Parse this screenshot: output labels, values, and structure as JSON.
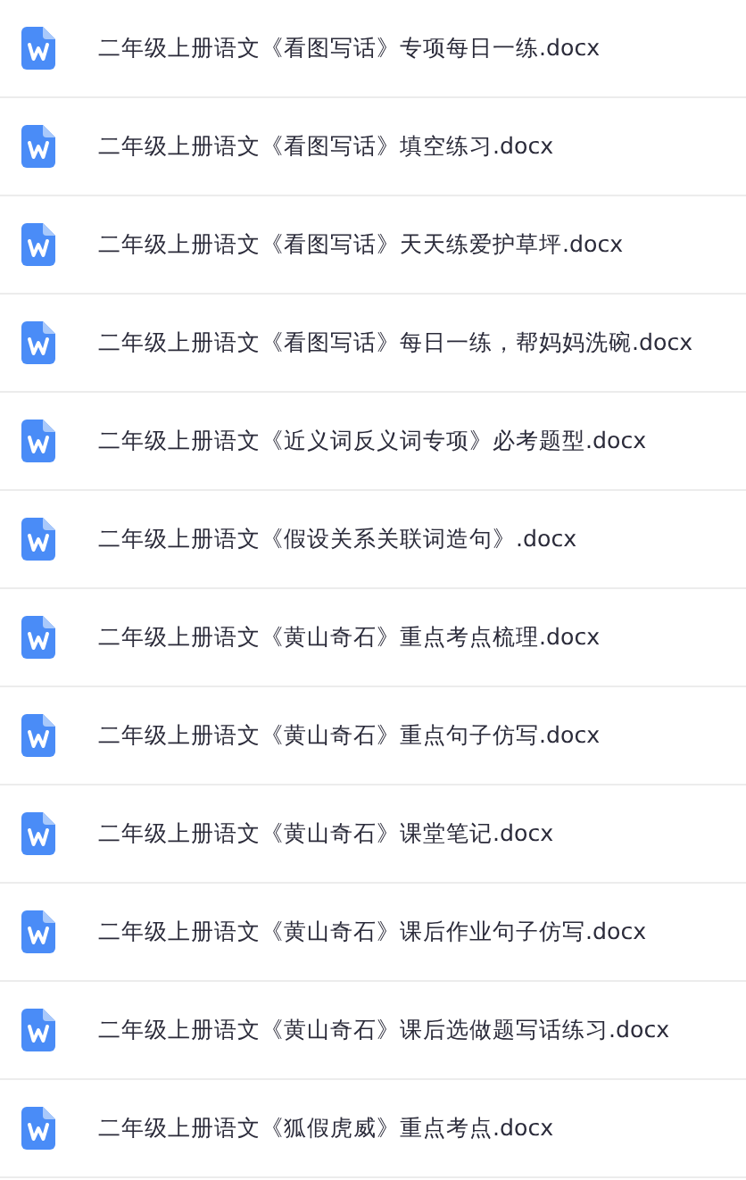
{
  "files": [
    {
      "name": "二年级上册语文《看图写话》专项每日一练.docx"
    },
    {
      "name": "二年级上册语文《看图写话》填空练习.docx"
    },
    {
      "name": "二年级上册语文《看图写话》天天练爱护草坪.docx"
    },
    {
      "name": "二年级上册语文《看图写话》每日一练，帮妈妈洗碗.docx"
    },
    {
      "name": "二年级上册语文《近义词反义词专项》必考题型.docx"
    },
    {
      "name": "二年级上册语文《假设关系关联词造句》.docx"
    },
    {
      "name": "二年级上册语文《黄山奇石》重点考点梳理.docx"
    },
    {
      "name": "二年级上册语文《黄山奇石》重点句子仿写.docx"
    },
    {
      "name": "二年级上册语文《黄山奇石》课堂笔记.docx"
    },
    {
      "name": "二年级上册语文《黄山奇石》课后作业句子仿写.docx"
    },
    {
      "name": "二年级上册语文《黄山奇石》课后选做题写话练习.docx"
    },
    {
      "name": "二年级上册语文《狐假虎威》重点考点.docx"
    }
  ]
}
